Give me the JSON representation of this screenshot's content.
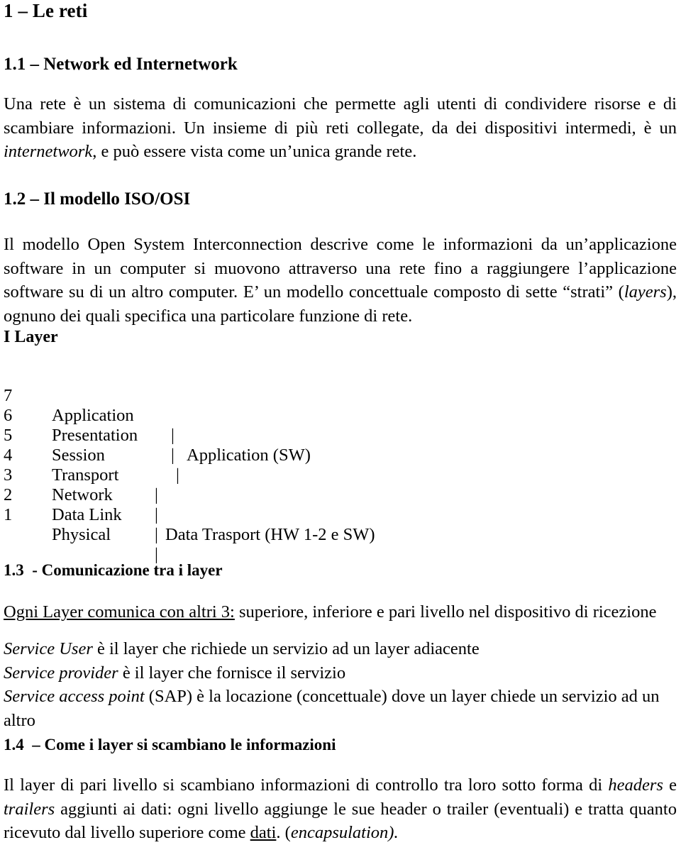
{
  "document": {
    "language": "it",
    "title": "1 – Le reti"
  },
  "sections": {
    "s1": {
      "heading": "1 – Le reti"
    },
    "s1_1": {
      "heading": "1.1 – Network ed Internetwork",
      "paragraph": {
        "part1": "Una rete è un sistema di comunicazioni che permette agli utenti di condividere risorse e di scambiare informazioni. Un insieme di più reti collegate, da dei dispositivi intermedi, è un ",
        "emphasis": "internetwork",
        "part2": ", e può essere vista come un’unica grande rete."
      }
    },
    "s1_2": {
      "heading": "1.2 – Il modello ISO/OSI",
      "paragraph": {
        "part1": "Il modello Open System Interconnection descrive come le informazioni da un’applicazione software in un computer si muovono attraverso una rete fino a raggiungere l’applicazione software su di un altro computer. E’ un modello concettuale composto di sette “strati” (",
        "emphasis": "layers",
        "part2": "), ognuno dei quali specifica una particolare funzione di rete."
      },
      "layers_title": "I Layer",
      "layers": [
        {
          "num": "7",
          "name": "Application",
          "bar": "|",
          "desc": "Application (SW)"
        },
        {
          "num": "6",
          "name": "Presentation",
          "bar": "|",
          "desc": ""
        },
        {
          "num": "5",
          "name": "Session",
          "bar": "|",
          "desc": ""
        },
        {
          "num": "4",
          "name": "Transport",
          "bar": "|",
          "desc": ""
        },
        {
          "num": "3",
          "name": "Network",
          "bar": "|",
          "desc": "Data Trasport (HW 1-2 e SW)"
        },
        {
          "num": "2",
          "name": "Data Link",
          "bar": "|",
          "desc": ""
        },
        {
          "num": "1",
          "name": "Physical",
          "bar": "|",
          "desc": ""
        }
      ]
    },
    "s1_3": {
      "heading": "1.3  - Comunicazione tra i layer",
      "intro": {
        "underlined": "Ogni Layer comunica con altri 3:",
        "rest": " superiore, inferiore e pari livello nel dispositivo di ricezione"
      },
      "definitions": [
        {
          "term": "Service User",
          "text": " è il layer che richiede un servizio ad un layer adiacente"
        },
        {
          "term": "Service provider",
          "text": "  è il layer che fornisce il servizio"
        },
        {
          "term": "Service access point",
          "text": " (SAP) è la locazione (concettuale) dove un layer chiede un servizio ad un altro"
        }
      ]
    },
    "s1_4": {
      "heading": "1.4  – Come i layer si scambiano le informazioni",
      "paragraph": {
        "part1": "Il layer di pari livello si scambiano informazioni di controllo tra loro sotto forma di ",
        "em1": "headers",
        "part2": " e ",
        "em2": "trailers",
        "part3": " aggiunti ai dati: ogni livello aggiunge le sue header o trailer (eventuali) e tratta quanto ricevuto dal livello superiore come ",
        "underlined": "dati",
        "part4": ". (",
        "em3": "encapsulation",
        "part5": ")."
      }
    }
  },
  "theme": {
    "page_background": "#ffffff",
    "text_color": "#000000"
  }
}
